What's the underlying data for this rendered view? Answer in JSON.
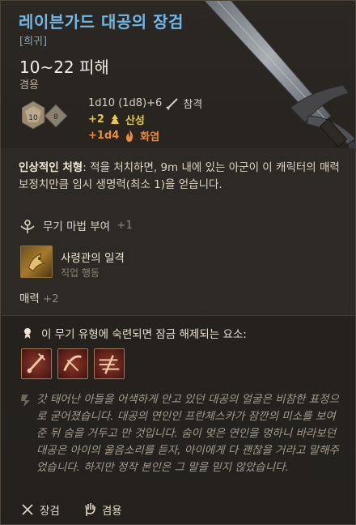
{
  "item": {
    "title": "레이븐가드 대공의 장검",
    "rarity": "[희귀]",
    "damage": "10~22 피해",
    "proficiency_label": "겸용",
    "dice_faces": [
      "10",
      "8"
    ],
    "damage_lines": [
      {
        "text": "1d10 (1d8)+6",
        "type": "참격",
        "icon": "slash-icon"
      },
      {
        "text": "+2",
        "type": "산성",
        "icon": "acid-icon"
      },
      {
        "text": "+1d4",
        "type": "화염",
        "icon": "fire-icon"
      }
    ]
  },
  "passive": {
    "name": "인상적인 처형",
    "description": ": 적을 처치하면, 9m 내에 있는 아군이 이 캐릭터의 매력 보정치만큼 임시 생명력(최소 1)을 얻습니다."
  },
  "enchant": {
    "label": "무기 마법 부여",
    "value": "+1"
  },
  "action": {
    "name": "사령관의 일격",
    "type": "직업 행동"
  },
  "stat": {
    "label": "매력",
    "value": "+2"
  },
  "proficiency_unlock": {
    "header": "이 무기 유형에 숙련되면 잠금 해제되는 요소:"
  },
  "flavor": "갓 태어난 아들을 어색하게 안고 있던 대공의 얼굴은 비참한 표정으로 굳어졌습니다. 대공의 연인인 프란체스카가 잠깐의 미소를 보여준 뒤 숨을 거두고 만 것입니다. 숨이 멎은 연인을 멍하니 바라보던 대공은 아이의 울음소리를 듣자, 아이에게 다 괜찮을 거라고 말해주었습니다. 하지만 정작 본인은 그 말을 믿지 않았습니다.",
  "footer": {
    "weapon_type": "장검",
    "handedness": "겸용"
  },
  "colors": {
    "title": "#6fb8e8",
    "acid": "#e5c84a",
    "fire": "#f08a3a",
    "rarity": "#8aa4b5"
  }
}
